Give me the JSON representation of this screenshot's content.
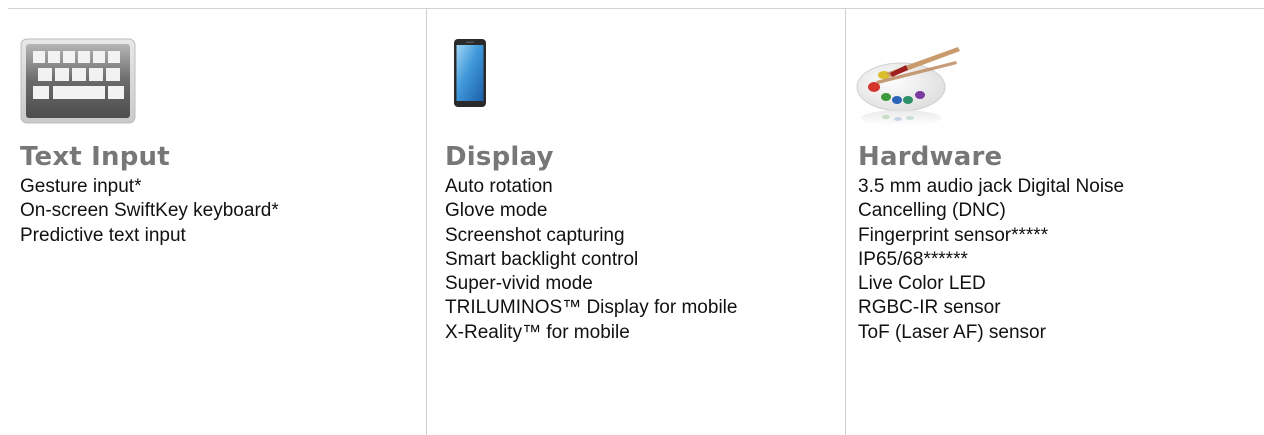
{
  "columns": [
    {
      "icon": "keyboard-icon",
      "title": "Text Input",
      "items": [
        "Gesture input*",
        "On-screen SwiftKey keyboard*",
        "Predictive text input"
      ]
    },
    {
      "icon": "smartphone-icon",
      "title": "Display",
      "items": [
        "Auto rotation",
        "Glove mode",
        "Screenshot capturing",
        "Smart backlight control",
        "Super-vivid mode",
        "TRILUMINOS™ Display for mobile",
        "X-Reality™ for mobile"
      ]
    },
    {
      "icon": "paint-palette-icon",
      "title": "Hardware",
      "items": [
        "3.5 mm audio jack Digital Noise",
        "Cancelling (DNC)",
        "Fingerprint sensor*****",
        "IP65/68******",
        "Live Color LED",
        "RGBC-IR sensor",
        "ToF (Laser AF) sensor"
      ]
    }
  ]
}
